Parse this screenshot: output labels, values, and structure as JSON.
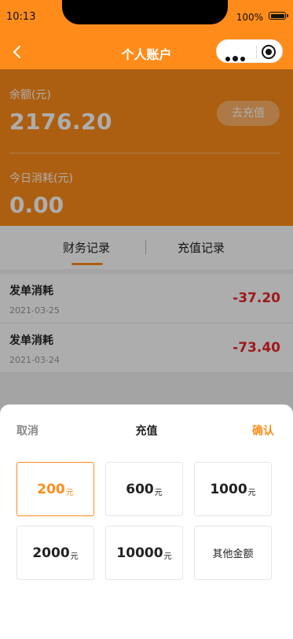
{
  "status_bar": {
    "time": "10:13",
    "battery": "100%"
  },
  "nav": {
    "title": "个人账户"
  },
  "account": {
    "balance_label": "余额(元)",
    "balance_value": "2176.20",
    "recharge_button": "去充值",
    "today_label": "今日消耗(元)",
    "today_value": "0.00"
  },
  "tabs": [
    {
      "label": "财务记录",
      "active": true
    },
    {
      "label": "充值记录",
      "active": false
    }
  ],
  "records": [
    {
      "title": "发单消耗",
      "date": "2021-03-25",
      "amount": "-37.20"
    },
    {
      "title": "发单消耗",
      "date": "2021-03-24",
      "amount": "-73.40"
    }
  ],
  "sheet": {
    "cancel": "取消",
    "title": "充值",
    "confirm": "确认",
    "unit": "元",
    "options": [
      {
        "amount": "200",
        "selected": true
      },
      {
        "amount": "600",
        "selected": false
      },
      {
        "amount": "1000",
        "selected": false
      },
      {
        "amount": "2000",
        "selected": false
      },
      {
        "amount": "10000",
        "selected": false
      }
    ],
    "other_amount": "其他金额"
  },
  "colors": {
    "accent": "#ff8c1a",
    "negative": "#e8262a"
  }
}
